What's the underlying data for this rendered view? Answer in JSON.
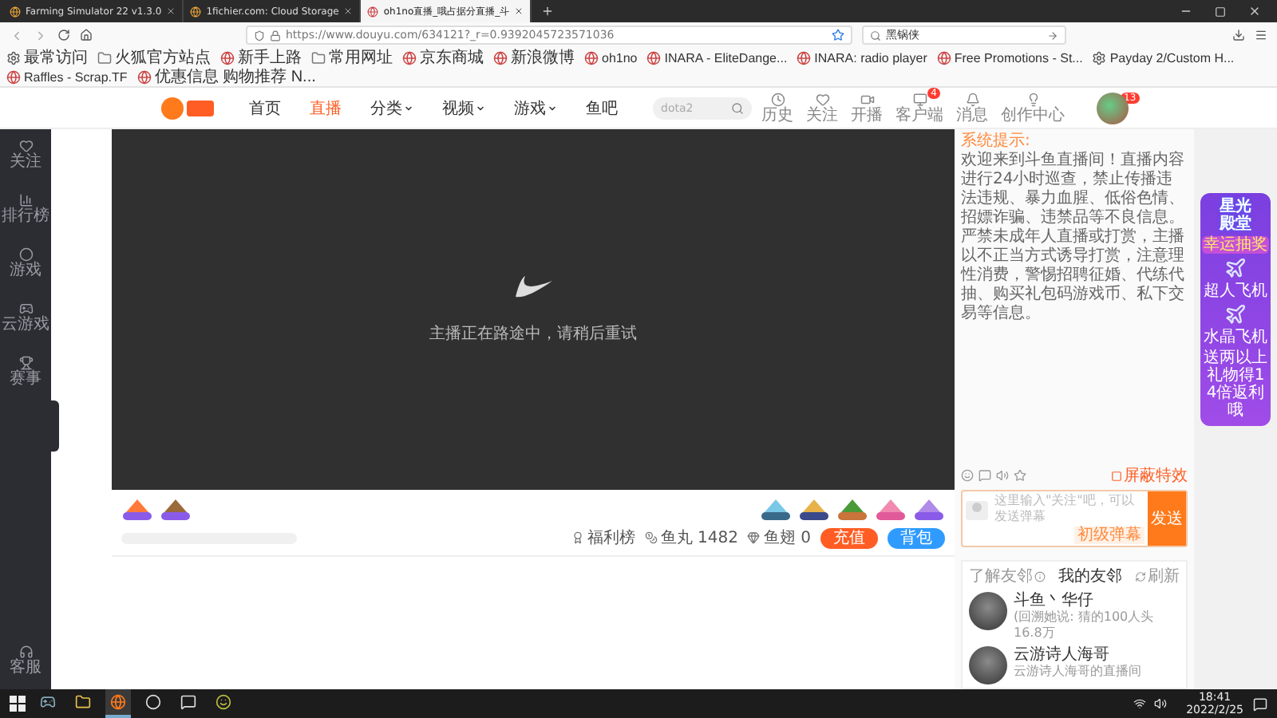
{
  "browser": {
    "tabs": [
      {
        "title": "Farming Simulator 22 v1.3.0",
        "selected": false
      },
      {
        "title": "1fichier.com: Cloud Storage",
        "selected": false
      },
      {
        "title": "oh1no直播_哦占据分直播_斗",
        "selected": true
      }
    ],
    "url": "https://www.douyu.com/634121?_r=0.9392045723571036",
    "search_value": "黑锅侠",
    "bookmarks": [
      {
        "label": "最常访问",
        "kind": "gear"
      },
      {
        "label": "火狐官方站点",
        "kind": "folder"
      },
      {
        "label": "新手上路",
        "kind": "site"
      },
      {
        "label": "常用网址",
        "kind": "folder"
      },
      {
        "label": "京东商城",
        "kind": "site"
      },
      {
        "label": "新浪微博",
        "kind": "site"
      },
      {
        "label": "oh1no",
        "kind": "site"
      },
      {
        "label": "INARA - EliteDange...",
        "kind": "site"
      },
      {
        "label": "INARA: radio player",
        "kind": "site"
      },
      {
        "label": "Free Promotions - St...",
        "kind": "site"
      },
      {
        "label": "Payday 2/Custom H...",
        "kind": "gear"
      },
      {
        "label": "Raffles - Scrap.TF",
        "kind": "site"
      },
      {
        "label": "优惠信息 购物推荐 N...",
        "kind": "site"
      }
    ]
  },
  "site_header": {
    "nav": [
      {
        "label": "首页",
        "selected": false,
        "dropdown": false
      },
      {
        "label": "直播",
        "selected": true,
        "dropdown": false
      },
      {
        "label": "分类",
        "selected": false,
        "dropdown": true
      },
      {
        "label": "视频",
        "selected": false,
        "dropdown": true
      },
      {
        "label": "游戏",
        "selected": false,
        "dropdown": true
      },
      {
        "label": "鱼吧",
        "selected": false,
        "dropdown": false
      }
    ],
    "search": {
      "placeholder": "dota2"
    },
    "actions": [
      {
        "label": "历史",
        "kind": "history"
      },
      {
        "label": "关注",
        "kind": "follow"
      },
      {
        "label": "开播",
        "kind": "stream"
      },
      {
        "label": "客户端",
        "kind": "client",
        "badge": "4"
      },
      {
        "label": "消息",
        "kind": "message"
      },
      {
        "label": "创作中心",
        "kind": "creator"
      }
    ],
    "avatar_badge": "13"
  },
  "sidebar": {
    "items": [
      {
        "label": "关注",
        "kind": "follow"
      },
      {
        "label": "排行榜",
        "kind": "rank"
      },
      {
        "label": "游戏",
        "kind": "game"
      },
      {
        "label": "云游戏",
        "kind": "cloud"
      },
      {
        "label": "赛事",
        "kind": "trophy"
      }
    ],
    "bottom": {
      "label": "客服",
      "kind": "support"
    }
  },
  "player": {
    "message": "主播正在路途中，请稍后重试"
  },
  "info_bar": {
    "stats": [
      {
        "label": "福利榜",
        "kind": "rank"
      },
      {
        "label": "鱼丸 1482",
        "kind": "fishball"
      },
      {
        "label": "鱼翅 0",
        "kind": "fin"
      }
    ],
    "buttons": [
      {
        "label": "充值",
        "kind": "primary"
      },
      {
        "label": "背包",
        "kind": "secondary"
      }
    ]
  },
  "chat": {
    "notice_label": "系统提示:",
    "notice": "欢迎来到斗鱼直播间！直播内容进行24小时巡查，禁止传播违法违规、暴力血腥、低俗色情、招嫖诈骗、违禁品等不良信息。严禁未成年人直播或打赏，主播以不正当方式诱导打赏，注意理性消费，警惕招聘征婚、代练代抽、购买礼包码游戏币、私下交易等信息。",
    "block_effects": "屏蔽特效",
    "input": {
      "placeholder": "这里输入\"关注\"吧，可以发送弹幕",
      "level_tag": "初级弹幕",
      "send": "发送"
    }
  },
  "friends": {
    "about": "了解友邻",
    "title": "我的友邻",
    "refresh": "刷新",
    "items": [
      {
        "name": "斗鱼丶华仔",
        "line": "(回溯她说: 猜的100人头",
        "stat": "16.8万"
      },
      {
        "name": "云游诗人海哥",
        "line": "云游诗人海哥的直播间"
      }
    ]
  },
  "promo": {
    "title": "星光殿堂",
    "subtitle": "幸运抽奖",
    "items": [
      "超人飞机",
      "水晶飞机"
    ],
    "footer": "送两以上礼物得14倍返利哦"
  },
  "taskbar": {
    "apps": [
      {
        "kind": "steam",
        "selected": false
      },
      {
        "kind": "folder",
        "selected": false
      },
      {
        "kind": "firefox",
        "selected": true
      },
      {
        "kind": "obs",
        "selected": false
      },
      {
        "kind": "chat",
        "selected": false
      },
      {
        "kind": "game",
        "selected": false
      }
    ],
    "time": "18:41",
    "date": "2022/2/25"
  }
}
